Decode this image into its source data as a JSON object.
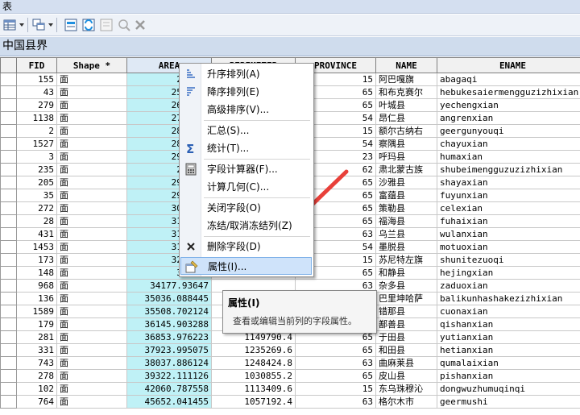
{
  "window": {
    "title": "表"
  },
  "layer": {
    "name": "中国县界"
  },
  "table": {
    "headers": [
      "FID",
      "Shape *",
      "AREA",
      "PERIMETER",
      "PROVINCE",
      "NAME",
      "ENAME"
    ],
    "rows": [
      [
        "155",
        "面",
        "25467.",
        "",
        "15",
        "阿巴嘎旗",
        "abagaqi"
      ],
      [
        "43",
        "面",
        "25794.0",
        "",
        "65",
        "和布克赛尔",
        "hebukesaiermengguzizhixian"
      ],
      [
        "279",
        "面",
        "26996.9",
        "",
        "65",
        "叶城县",
        "yechengxian"
      ],
      [
        "1138",
        "面",
        "27442.7",
        "",
        "54",
        "昂仁县",
        "angrenxian"
      ],
      [
        "2",
        "面",
        "28245.7",
        "",
        "15",
        "额尔古纳右",
        "geergunyouqi"
      ],
      [
        "1527",
        "面",
        "28814.9",
        "",
        "54",
        "察隅县",
        "chayuxian"
      ],
      [
        "3",
        "面",
        "29349.4",
        "",
        "23",
        "呼玛县",
        "humaxian"
      ],
      [
        "235",
        "面",
        "29399.",
        "",
        "62",
        "肃北蒙古族",
        "shubeimengguzuzizhixian"
      ],
      [
        "205",
        "面",
        "29612.8",
        "",
        "65",
        "沙雅县",
        "shayaxian"
      ],
      [
        "35",
        "面",
        "29798.7",
        "",
        "65",
        "富蕴县",
        "fuyunxian"
      ],
      [
        "272",
        "面",
        "30415.9",
        "",
        "65",
        "策勒县",
        "celexian"
      ],
      [
        "28",
        "面",
        "31010.3",
        "",
        "65",
        "福海县",
        "fuhaixian"
      ],
      [
        "431",
        "面",
        "31465.7",
        "",
        "63",
        "乌兰县",
        "wulanxian"
      ],
      [
        "1453",
        "面",
        "31485.7",
        "",
        "54",
        "墨脱县",
        "motuoxian"
      ],
      [
        "173",
        "面",
        "32636.0",
        "",
        "15",
        "苏尼特左旗",
        "shunitezuoqi"
      ],
      [
        "148",
        "面",
        "33572.",
        "",
        "65",
        "和静县",
        "hejingxian"
      ],
      [
        "968",
        "面",
        "34177.93647",
        "",
        "63",
        "杂多县",
        "zaduoxian"
      ],
      [
        "136",
        "面",
        "35036.088445",
        "",
        "15",
        "巴里坤哈萨",
        "balikunhashakezizhixian"
      ],
      [
        "1589",
        "面",
        "35508.702124",
        "",
        "54",
        "错那县",
        "cuonaxian"
      ],
      [
        "179",
        "面",
        "36145.903288",
        "",
        "65",
        "鄯善县",
        "qishanxian"
      ],
      [
        "281",
        "面",
        "36853.976223",
        "1149790.4",
        "65",
        "于田县",
        "yutianxian"
      ],
      [
        "331",
        "面",
        "37923.995075",
        "1235269.6",
        "65",
        "和田县",
        "hetianxian"
      ],
      [
        "743",
        "面",
        "38037.886124",
        "1248424.8",
        "63",
        "曲麻莱县",
        "qumalaixian"
      ],
      [
        "278",
        "面",
        "39322.111126",
        "1030855.2",
        "65",
        "皮山县",
        "pishanxian"
      ],
      [
        "102",
        "面",
        "42060.787558",
        "1113409.6",
        "15",
        "东乌珠穆沁",
        "dongwuzhumuqinqi"
      ],
      [
        "764",
        "面",
        "45652.041455",
        "1057192.4",
        "63",
        "格尔木市",
        "geermushi"
      ]
    ]
  },
  "context_menu": {
    "items": [
      "升序排列(A)",
      "降序排列(E)",
      "高级排序(V)...",
      "汇总(S)...",
      "统计(T)...",
      "字段计算器(F)...",
      "计算几何(C)...",
      "关闭字段(O)",
      "冻结/取消冻结列(Z)",
      "删除字段(D)",
      "属性(I)..."
    ]
  },
  "tooltip": {
    "title": "属性(I)",
    "description": "查看或编辑当前列的字段属性。"
  },
  "colors": {
    "selected_column": "#bff1f6",
    "highlight": "#cfe3fa",
    "arrow": "#e8403a"
  }
}
